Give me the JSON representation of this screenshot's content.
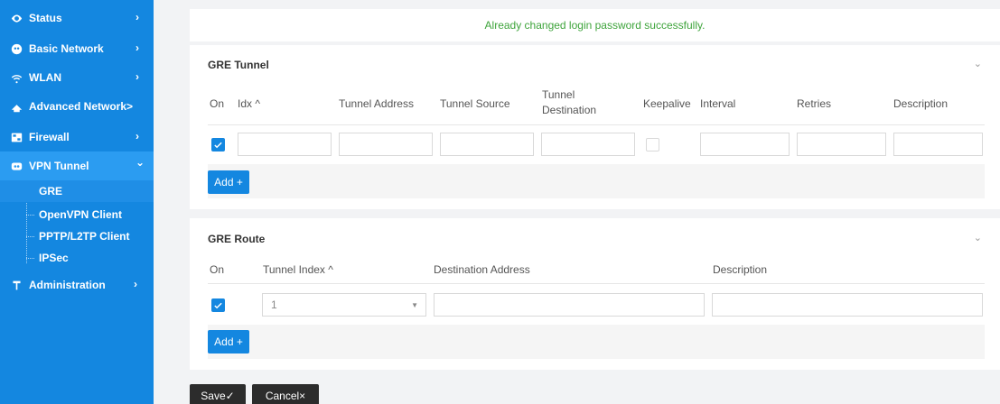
{
  "sidebar": {
    "items": [
      {
        "label": "Status",
        "icon": "eye-icon"
      },
      {
        "label": "Basic Network",
        "icon": "globe-icon"
      },
      {
        "label": "WLAN",
        "icon": "wifi-icon"
      },
      {
        "label": "Advanced Network>",
        "icon": "cloud-icon"
      },
      {
        "label": "Firewall",
        "icon": "firewall-icon"
      },
      {
        "label": "VPN Tunnel",
        "icon": "vpn-icon"
      },
      {
        "label": "Administration",
        "icon": "admin-icon"
      }
    ],
    "chevron_right": "›",
    "chevron_down": "⌄",
    "vpn_children": [
      "GRE",
      "OpenVPN Client",
      "PPTP/L2TP Client",
      "IPSec"
    ]
  },
  "notice": "Already changed login password successfully.",
  "gre_tunnel": {
    "title": "GRE Tunnel",
    "collapse_glyph": "⌄",
    "columns": [
      "On",
      "Idx ^",
      "Tunnel Address",
      "Tunnel Source",
      "Tunnel",
      "Destination",
      "Keepalive",
      "Interval",
      "Retries",
      "Description"
    ],
    "row": {
      "on": true,
      "keepalive": false
    },
    "add_label": "Add +"
  },
  "gre_route": {
    "title": "GRE Route",
    "collapse_glyph": "⌄",
    "columns": [
      "On",
      "Tunnel Index ^",
      "Destination Address",
      "Description"
    ],
    "row": {
      "on": true,
      "tunnel_index": "1"
    },
    "add_label": "Add +"
  },
  "footer": {
    "save_label": "Save✓",
    "cancel_label": "Cancel×"
  },
  "colors": {
    "accent": "#1487e0",
    "success": "#3ea43b",
    "dark_button": "#2c2c2c"
  }
}
